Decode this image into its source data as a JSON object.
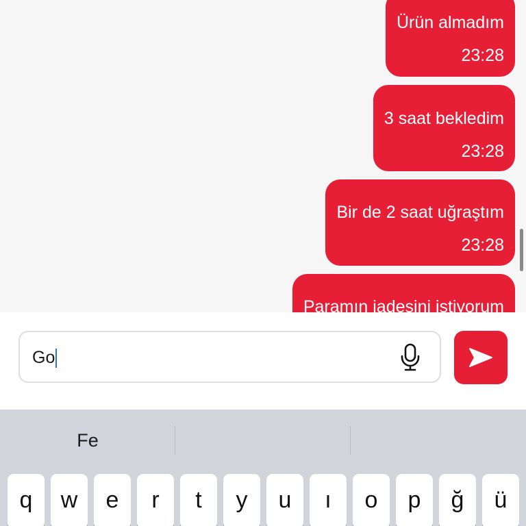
{
  "colors": {
    "accent": "#e61e36",
    "chat_background": "#f6f6f6",
    "keyboard_background": "#d1d4db",
    "caret": "#2f6de0"
  },
  "messages": [
    {
      "text": "Ürün almadım",
      "time": "23:28"
    },
    {
      "text": "3 saat bekledim",
      "time": "23:28"
    },
    {
      "text": "Bir de 2 saat uğraştım",
      "time": "23:28"
    },
    {
      "text": "Paramın iadesini istiyorum"
    }
  ],
  "composer": {
    "value": "Go",
    "mic_icon": "microphone-icon",
    "send_icon": "send-arrow-icon"
  },
  "keyboard": {
    "suggestions": [
      "Fe",
      "",
      ""
    ],
    "keys": [
      "q",
      "w",
      "e",
      "r",
      "t",
      "y",
      "u",
      "ı",
      "o",
      "p",
      "ğ",
      "ü"
    ]
  }
}
